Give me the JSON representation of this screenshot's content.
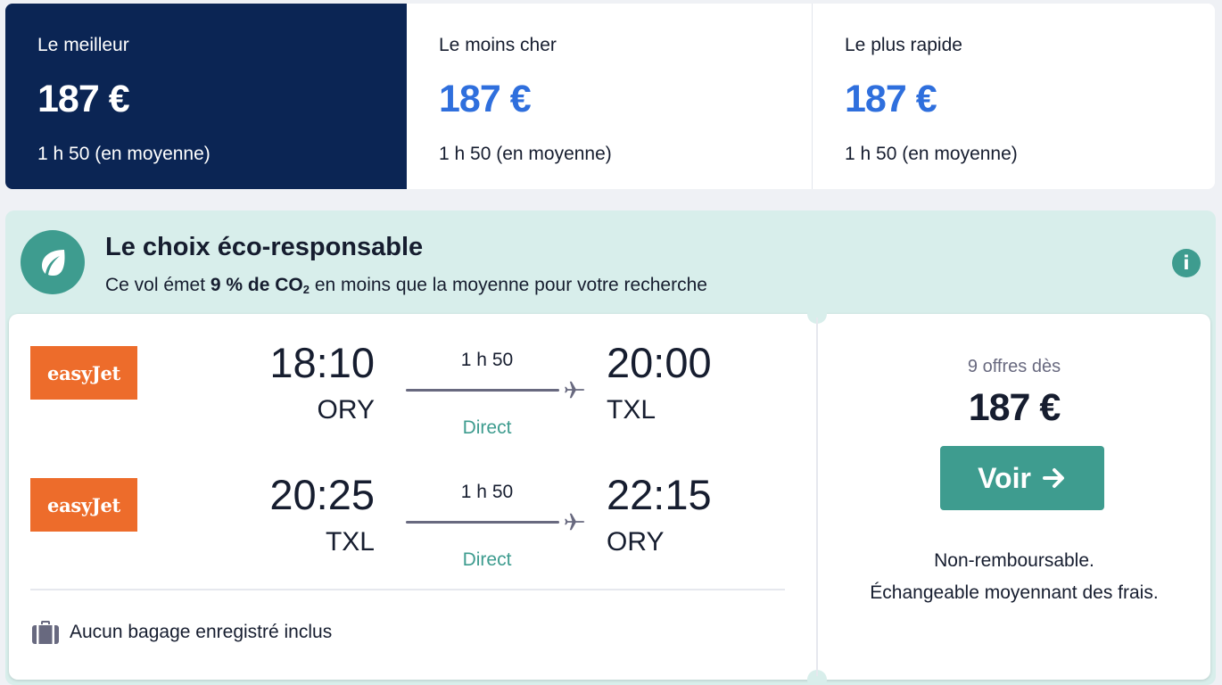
{
  "tabs": [
    {
      "title": "Le meilleur",
      "price": "187 €",
      "subtitle": "1 h 50 (en moyenne)",
      "selected": true
    },
    {
      "title": "Le moins cher",
      "price": "187 €",
      "subtitle": "1 h 50 (en moyenne)",
      "selected": false
    },
    {
      "title": "Le plus rapide",
      "price": "187 €",
      "subtitle": "1 h 50 (en moyenne)",
      "selected": false
    }
  ],
  "eco": {
    "title": "Le choix éco-responsable",
    "desc_prefix": "Ce vol émet",
    "desc_bold": "9 % de CO",
    "desc_sub": "2",
    "desc_suffix": "en moins que la moyenne pour votre recherche",
    "icon": "leaf-icon",
    "info_icon": "info-icon",
    "info_glyph": "i"
  },
  "legs": [
    {
      "airline": "easyJet",
      "dep_time": "18:10",
      "dep_code": "ORY",
      "duration": "1 h 50",
      "stops": "Direct",
      "arr_time": "20:00",
      "arr_code": "TXL"
    },
    {
      "airline": "easyJet",
      "dep_time": "20:25",
      "dep_code": "TXL",
      "duration": "1 h 50",
      "stops": "Direct",
      "arr_time": "22:15",
      "arr_code": "ORY"
    }
  ],
  "baggage": {
    "label": "Aucun bagage enregistré inclus",
    "icon": "baggage-icon"
  },
  "pricing": {
    "offers_label": "9 offres dès",
    "price": "187 €",
    "cta_label": "Voir",
    "note_line1": "Non-remboursable.",
    "note_line2": "Échangeable moyennant des frais."
  },
  "colors": {
    "selected_tab": "#0b2554",
    "price_blue": "#2f6fdd",
    "eco_bg": "#d8eeeb",
    "eco_green": "#3e9c8f",
    "easyjet_orange": "#ed6c2b",
    "text_dark": "#161d2f"
  }
}
